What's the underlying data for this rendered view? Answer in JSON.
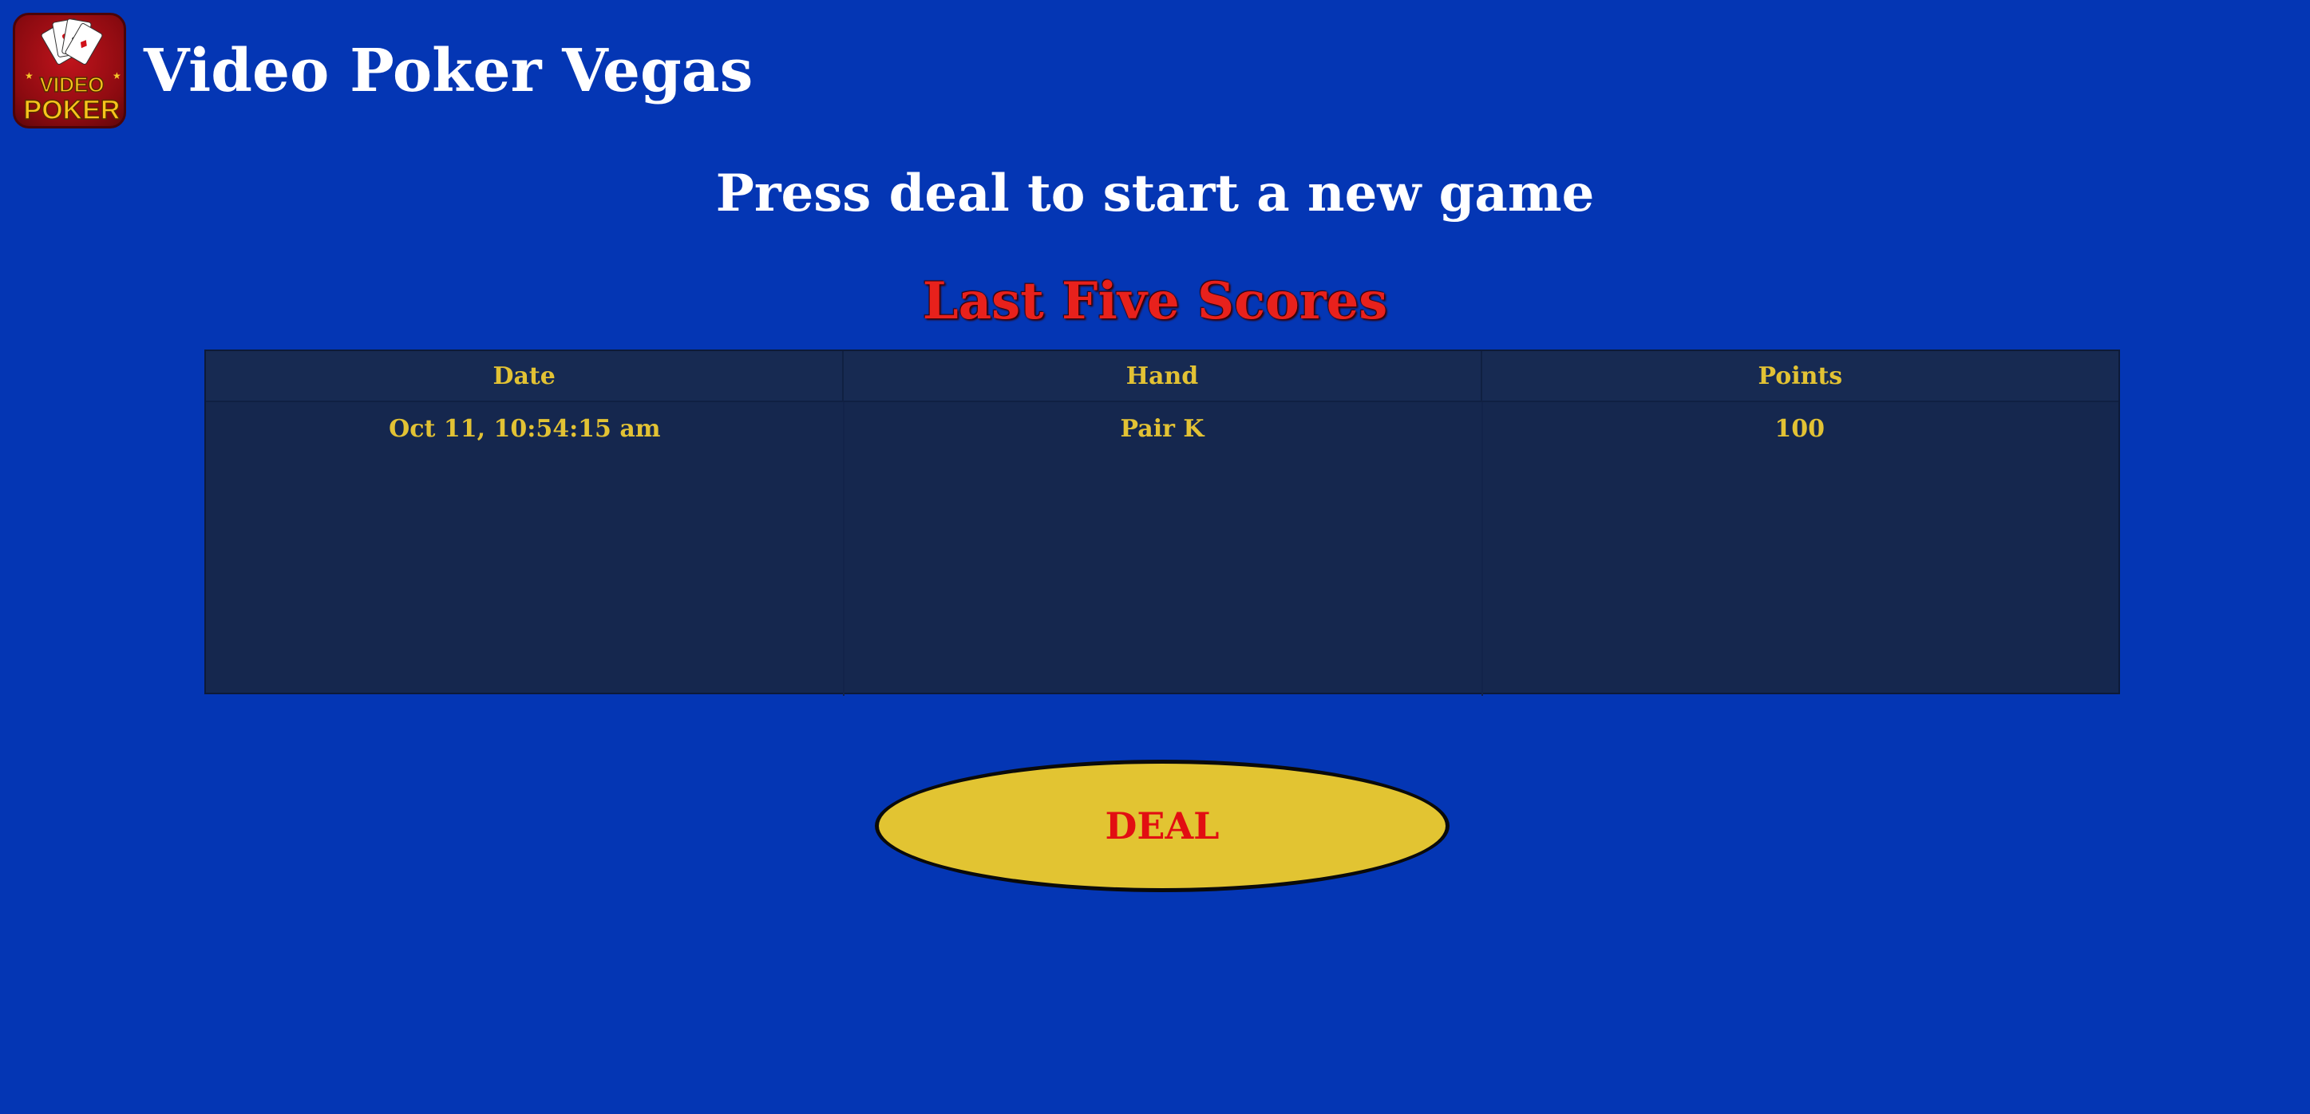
{
  "header": {
    "logo_text_top": "VIDEO",
    "logo_text_bottom": "POKER",
    "app_title": "Video Poker Vegas"
  },
  "status": {
    "message": "Press deal to start a new game"
  },
  "scores": {
    "title": "Last Five Scores",
    "columns": [
      "Date",
      "Hand",
      "Points"
    ],
    "rows": [
      {
        "date": "Oct 11, 10:54:15 am",
        "hand": "Pair K",
        "points": "100"
      }
    ]
  },
  "controls": {
    "deal_label": "DEAL"
  },
  "colors": {
    "background": "#0436b4",
    "table_bg": "#15274e",
    "table_text": "#e2c234",
    "title_red": "#e8211c",
    "deal_button": "#e2c432",
    "deal_text": "#e20e12"
  }
}
